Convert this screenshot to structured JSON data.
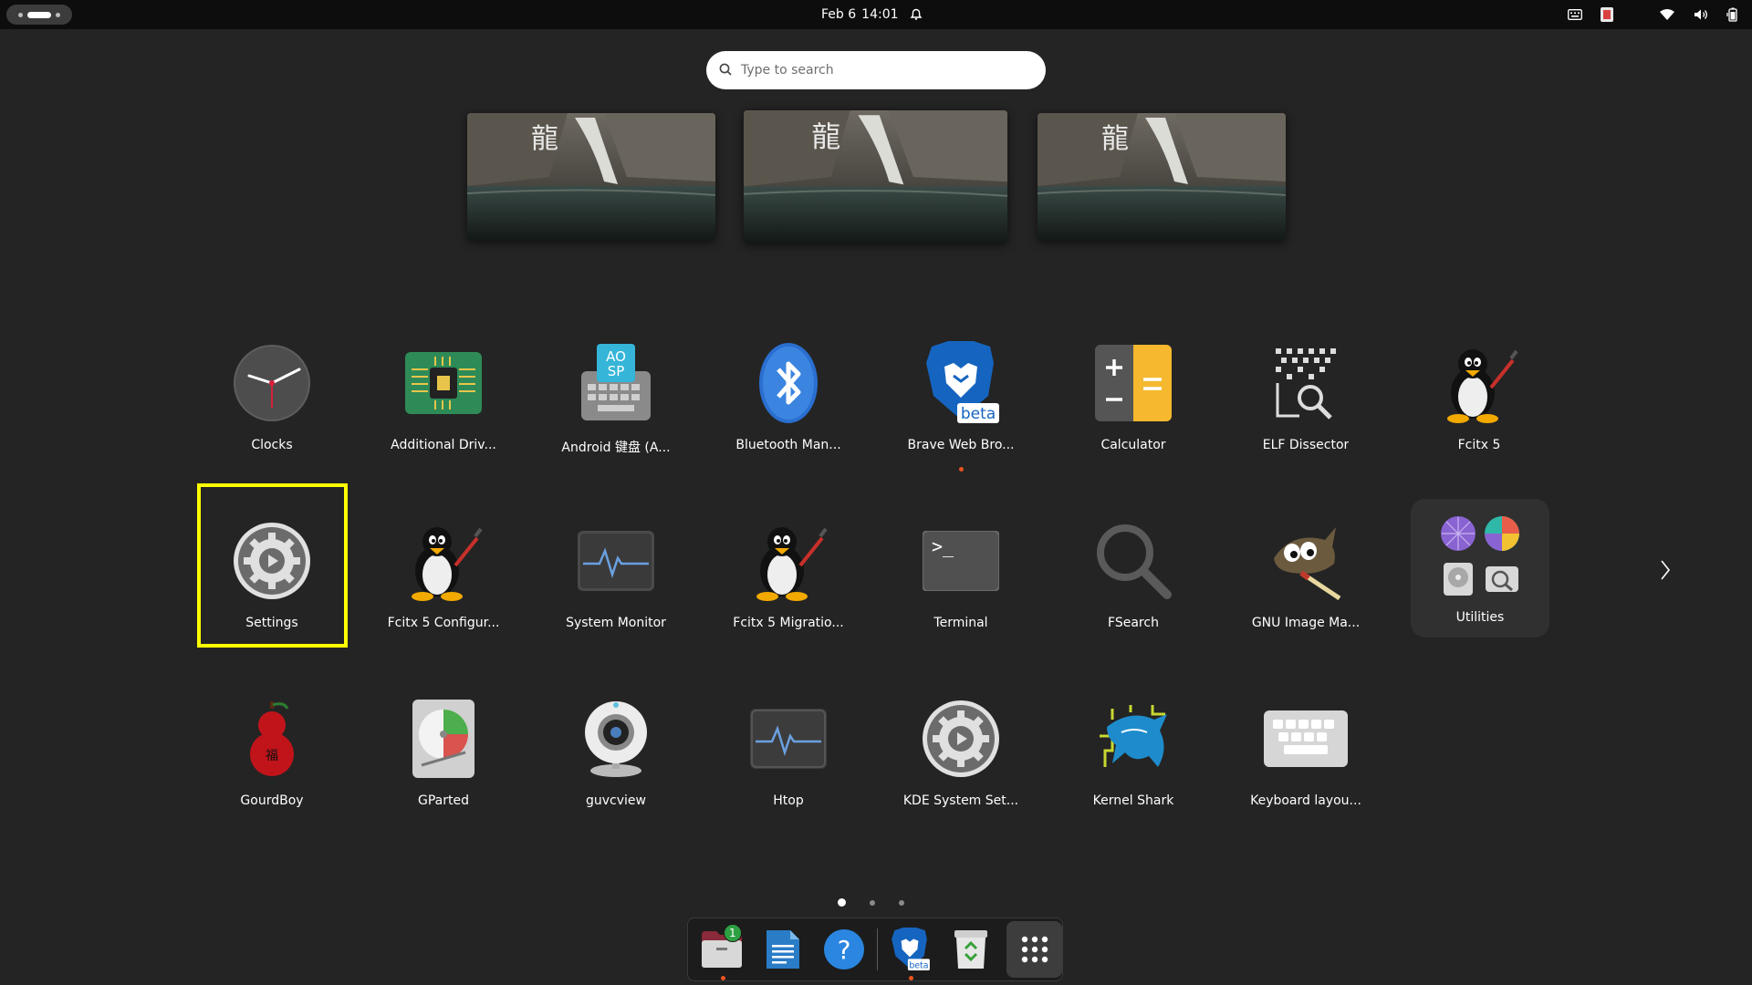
{
  "topbar": {
    "date": "Feb 6",
    "time": "14:01",
    "icons": [
      "activities-indicator",
      "notification-bell-icon",
      "keyboard-icon",
      "fcitx-indicator-icon",
      "wifi-icon",
      "volume-icon",
      "battery-icon"
    ]
  },
  "search": {
    "placeholder": "Type to search"
  },
  "workspaces": [
    {
      "name": "workspace-1"
    },
    {
      "name": "workspace-2"
    },
    {
      "name": "workspace-3"
    }
  ],
  "apps": {
    "row1": [
      {
        "label": "Clocks",
        "icon": "clock-icon"
      },
      {
        "label": "Additional Driv...",
        "icon": "chip-icon"
      },
      {
        "label": "Android 键盘 (A...",
        "icon": "aosp-keyboard-icon"
      },
      {
        "label": "Bluetooth Man...",
        "icon": "bluetooth-icon"
      },
      {
        "label": "Brave Web Bro...",
        "icon": "brave-beta-icon",
        "running": true
      },
      {
        "label": "Calculator",
        "icon": "calculator-icon"
      },
      {
        "label": "ELF Dissector",
        "icon": "elf-dissector-icon"
      },
      {
        "label": "Fcitx 5",
        "icon": "tux-icon"
      }
    ],
    "row2": [
      {
        "label": "Settings",
        "icon": "gear-icon",
        "selected": true
      },
      {
        "label": "Fcitx 5 Configur...",
        "icon": "tux-icon"
      },
      {
        "label": "System Monitor",
        "icon": "system-monitor-icon"
      },
      {
        "label": "Fcitx 5 Migratio...",
        "icon": "tux-icon"
      },
      {
        "label": "Terminal",
        "icon": "terminal-icon"
      },
      {
        "label": "FSearch",
        "icon": "magnifier-icon"
      },
      {
        "label": "GNU Image Ma...",
        "icon": "gimp-icon"
      }
    ],
    "folder": {
      "label": "Utilities"
    },
    "row3": [
      {
        "label": "GourdBoy",
        "icon": "gourd-icon"
      },
      {
        "label": "GParted",
        "icon": "gparted-icon"
      },
      {
        "label": "guvcview",
        "icon": "webcam-icon"
      },
      {
        "label": "Htop",
        "icon": "htop-icon"
      },
      {
        "label": "KDE System Set...",
        "icon": "kde-gear-icon"
      },
      {
        "label": "Kernel Shark",
        "icon": "kernelshark-icon"
      },
      {
        "label": "Keyboard layou...",
        "icon": "keyboard-layout-icon"
      }
    ]
  },
  "pager": {
    "pages": 3,
    "current": 1
  },
  "dock": {
    "items": [
      {
        "name": "files",
        "icon": "files-icon",
        "badge": "1",
        "running": true
      },
      {
        "name": "text-editor",
        "icon": "document-icon"
      },
      {
        "name": "help",
        "icon": "help-icon"
      },
      {
        "name": "brave-beta",
        "icon": "brave-beta-icon",
        "running": true
      },
      {
        "name": "trash",
        "icon": "trash-icon"
      },
      {
        "name": "show-apps",
        "icon": "app-grid-icon"
      }
    ]
  },
  "colors": {
    "background": "#242424",
    "topbar": "#0d0d0d",
    "accent_running": "#e95420",
    "selection_outline": "#ffff00"
  }
}
